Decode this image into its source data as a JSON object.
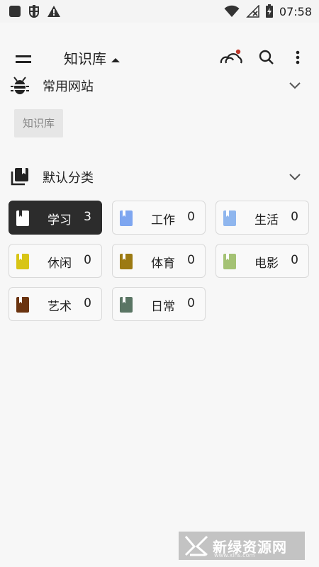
{
  "status_bar": {
    "time": "07:58",
    "left_icons": [
      "square-notification-icon",
      "bug-notification-icon",
      "warning-icon"
    ],
    "right_icons": [
      "wifi-icon",
      "no-signal-icon",
      "battery-icon"
    ]
  },
  "app_bar": {
    "title": "知识库",
    "icons": [
      "menu-icon",
      "dropdown-arrow-icon",
      "cloud-sync-icon",
      "search-icon",
      "more-vert-icon"
    ],
    "sync_dot_color": "#c0392b"
  },
  "websites_section": {
    "title": "常用网站",
    "icon": "bug-icon",
    "chips": [
      "知识库"
    ]
  },
  "categories_section": {
    "title": "默认分类",
    "icon": "library-books-icon",
    "categories": [
      {
        "name": "学习",
        "count": "3",
        "color": "#ffffff",
        "active": true
      },
      {
        "name": "工作",
        "count": "0",
        "color": "#7ea6f0",
        "active": false
      },
      {
        "name": "生活",
        "count": "0",
        "color": "#8fb6ee",
        "active": false
      },
      {
        "name": "休闲",
        "count": "0",
        "color": "#d8c515",
        "active": false
      },
      {
        "name": "体育",
        "count": "0",
        "color": "#9c7a12",
        "active": false
      },
      {
        "name": "电影",
        "count": "0",
        "color": "#a4c274",
        "active": false
      },
      {
        "name": "艺术",
        "count": "0",
        "color": "#6b3410",
        "active": false
      },
      {
        "name": "日常",
        "count": "0",
        "color": "#5a7564",
        "active": false
      }
    ]
  },
  "watermark": {
    "text": "新绿资源网",
    "subtext": "www.xlhs.com"
  }
}
